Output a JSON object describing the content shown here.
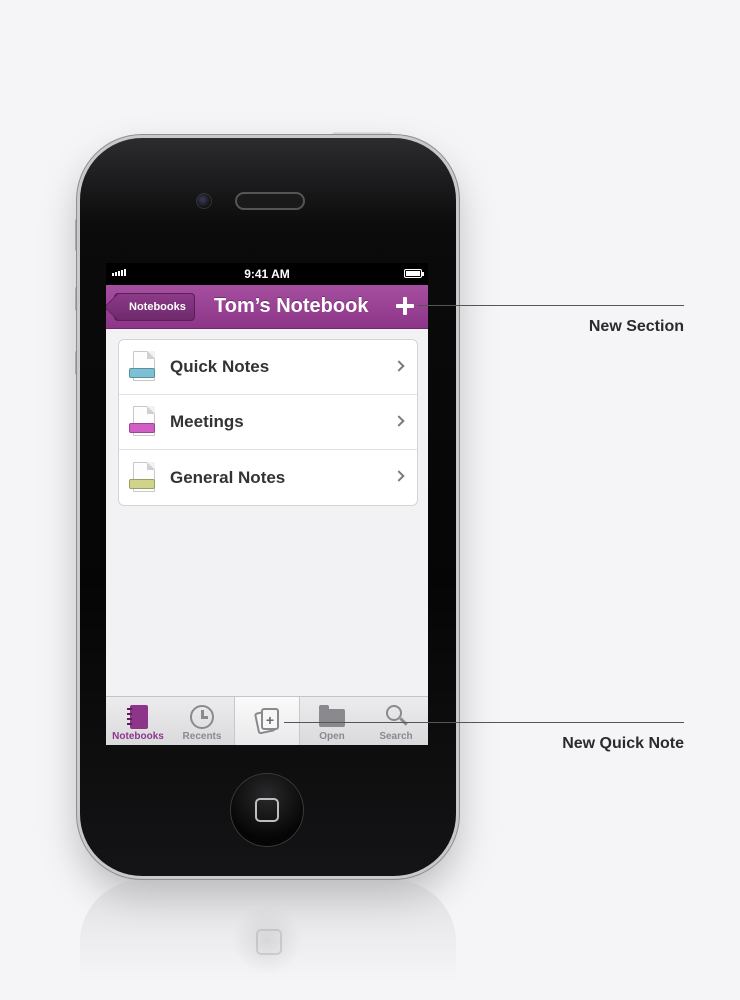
{
  "status_bar": {
    "time": "9:41 AM"
  },
  "nav_bar": {
    "back_label": "Notebooks",
    "title": "Tom’s Notebook"
  },
  "sections": [
    {
      "label": "Quick Notes",
      "color": "#7cc0d4"
    },
    {
      "label": "Meetings",
      "color": "#d05ec4"
    },
    {
      "label": "General Notes",
      "color": "#cfd48a"
    }
  ],
  "tab_bar": {
    "tabs": [
      {
        "label": "Notebooks",
        "icon": "notebook-icon",
        "active": true
      },
      {
        "label": "Recents",
        "icon": "clock-icon",
        "active": false
      },
      {
        "label": "",
        "icon": "quick-note-icon",
        "active": false
      },
      {
        "label": "Open",
        "icon": "folder-icon",
        "active": false
      },
      {
        "label": "Search",
        "icon": "search-icon",
        "active": false
      }
    ]
  },
  "callouts": {
    "new_section": "New Section",
    "new_quick_note": "New Quick Note"
  },
  "colors": {
    "accent": "#8d3689",
    "background": "#f5f5f7"
  }
}
